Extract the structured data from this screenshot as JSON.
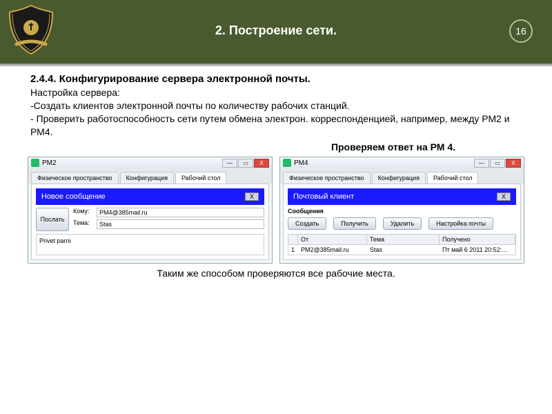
{
  "header": {
    "title": "2.  Построение сети.",
    "page_num": "16"
  },
  "section": {
    "heading": "2.4.4. Конфигурирование сервера электронной почты.",
    "line1": "Настройка  сервера:",
    "line2": "-Создать клиентов электронной почты по количеству рабочих станций.",
    "line3": "- Проверить работоспособность сети путем обмена электрон. корреспонденцией, например, между РМ2 и РМ4."
  },
  "check_label": "Проверяем ответ на РМ 4.",
  "win_left": {
    "title": "PM2",
    "tabs": {
      "t1": "Физическое пространство",
      "t2": "Конфигурация",
      "t3": "Рабочий стол"
    },
    "panel_title": "Новое сообщение",
    "close_x": "X",
    "send_btn": "Послать",
    "to_label": "Кому:",
    "to_val": "PM4@385mail.ru",
    "subj_label": "Тема:",
    "subj_val": "Stas",
    "body": "Privet parni"
  },
  "win_right": {
    "title": "PM4",
    "tabs": {
      "t1": "Физическое пространство",
      "t2": "Конфигурация",
      "t3": "Рабочий стол"
    },
    "panel_title": "Почтовый клиент",
    "close_x": "X",
    "sub_label": "Сообщения",
    "btns": {
      "b1": "Создать",
      "b2": "Получить",
      "b3": "Удалить",
      "b4": "Настройка почты"
    },
    "cols": {
      "from": "От",
      "subj": "Тема",
      "recv": "Получено"
    },
    "row": {
      "idx": "1",
      "from": "PM2@385mail.ru",
      "subj": "Stas",
      "recv": "Пт май 6 2011 20:52:…"
    }
  },
  "footnote": "Таким же способом проверяются все рабочие места.",
  "winctrl": {
    "min": "—",
    "max": "▭",
    "close": "X"
  }
}
